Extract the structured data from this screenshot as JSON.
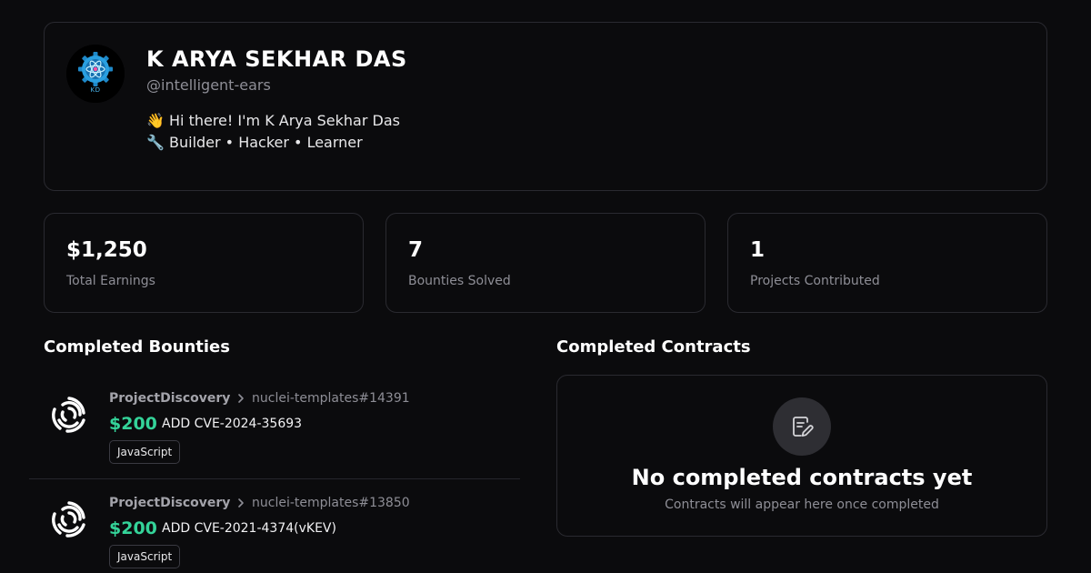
{
  "profile": {
    "name": "K ARYA SEKHAR DAS",
    "handle": "@intelligent-ears",
    "avatar_initials": "KD",
    "bio_line1": "👋 Hi there! I'm K Arya Sekhar Das",
    "bio_line2": "🔧 Builder • Hacker • Learner"
  },
  "stats": [
    {
      "value": "$1,250",
      "label": "Total Earnings"
    },
    {
      "value": "7",
      "label": "Bounties Solved"
    },
    {
      "value": "1",
      "label": "Projects Contributed"
    }
  ],
  "bounties_section": {
    "title": "Completed Bounties",
    "items": [
      {
        "org": "ProjectDiscovery",
        "repo": "nuclei-templates#14391",
        "amount": "$200",
        "title": "ADD CVE-2024-35693",
        "tag": "JavaScript",
        "logo_icon": "projectdiscovery-logo-icon"
      },
      {
        "org": "ProjectDiscovery",
        "repo": "nuclei-templates#13850",
        "amount": "$200",
        "title": "ADD CVE-2021-4374(vKEV)",
        "tag": "JavaScript",
        "logo_icon": "projectdiscovery-logo-icon"
      }
    ]
  },
  "contracts_section": {
    "title": "Completed Contracts",
    "empty_icon": "contract-edit-icon",
    "empty_title": "No completed contracts yet",
    "empty_subtitle": "Contracts will appear here once completed"
  },
  "colors": {
    "background": "#0b0b0d",
    "border": "#2a2a30",
    "accent_green": "#34d399",
    "muted_text": "#8e8e96"
  }
}
